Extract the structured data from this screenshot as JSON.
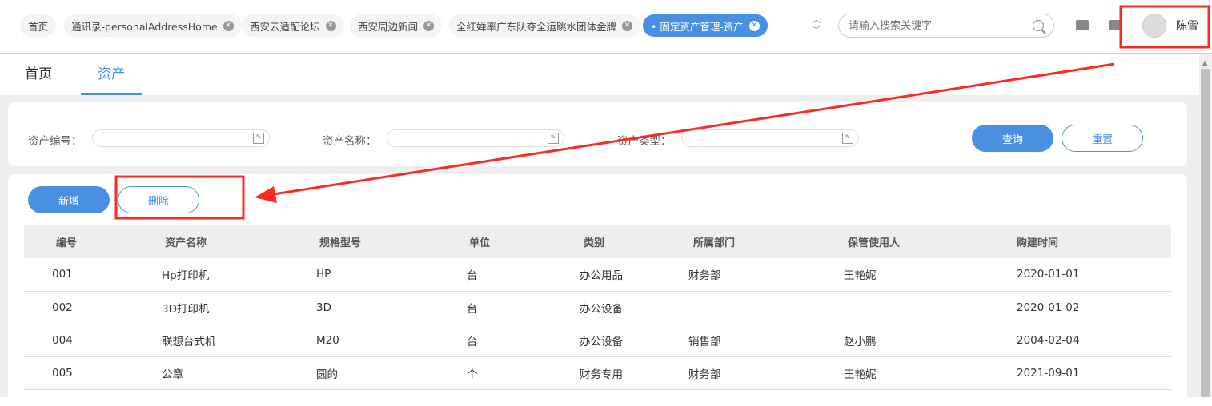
{
  "tabs": [
    {
      "label": "首页",
      "closable": false
    },
    {
      "label": "通讯录-personalAddressHome",
      "closable": true
    },
    {
      "label": "西安云适配论坛",
      "closable": true
    },
    {
      "label": "西安周边新闻",
      "closable": true
    },
    {
      "label": "全红婵率广东队夺全运跳水团体金牌",
      "closable": true
    },
    {
      "label": "• 固定资产管理-资产",
      "closable": true,
      "active": true
    }
  ],
  "search": {
    "placeholder": "请输入搜索关键字"
  },
  "user": {
    "name": "陈雪"
  },
  "subtabs": [
    "首页",
    "资产"
  ],
  "filters": {
    "asset_no": "资产编号：",
    "asset_name": "资产名称：",
    "asset_type": "资产类型："
  },
  "buttons": {
    "query": "查询",
    "reset": "重置",
    "add": "新增",
    "delete": "删除"
  },
  "table": {
    "headers": [
      "编号",
      "资产名称",
      "规格型号",
      "单位",
      "类别",
      "所属部门",
      "保管使用人",
      "购建时间"
    ],
    "rows": [
      [
        "001",
        "Hp打印机",
        "HP",
        "台",
        "办公用品",
        "财务部",
        "王艳妮",
        "2020-01-01"
      ],
      [
        "002",
        "3D打印机",
        "3D",
        "台",
        "办公设备",
        "",
        "",
        "2020-01-02"
      ],
      [
        "004",
        "联想台式机",
        "M20",
        "台",
        "办公设备",
        "销售部",
        "赵小鹏",
        "2004-02-04"
      ],
      [
        "005",
        "公章",
        "圆的",
        "个",
        "财务专用",
        "财务部",
        "王艳妮",
        "2021-09-01"
      ]
    ]
  },
  "colors": {
    "accent": "#4a90e2",
    "annotation": "#ff2a1f"
  }
}
